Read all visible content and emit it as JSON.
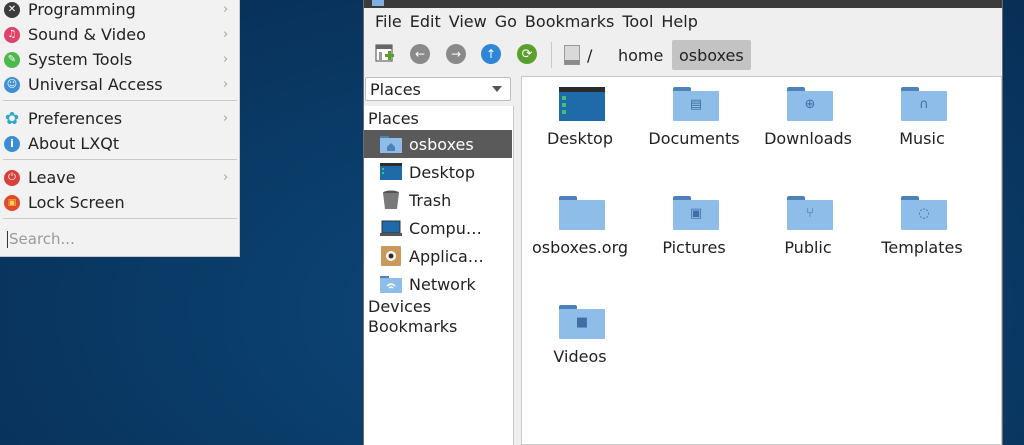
{
  "menu": {
    "items": [
      {
        "label": "Programming",
        "icon": "programming-icon",
        "color": "#3c3c3c",
        "glyph": "✕",
        "submenu": true
      },
      {
        "label": "Sound & Video",
        "icon": "sound-video-icon",
        "color": "#e0436a",
        "glyph": "♫",
        "submenu": true
      },
      {
        "label": "System Tools",
        "icon": "system-tools-icon",
        "color": "#4db84b",
        "glyph": "✎",
        "submenu": true
      },
      {
        "label": "Universal Access",
        "icon": "universal-access-icon",
        "color": "#3d8fd6",
        "glyph": "☺",
        "submenu": true
      },
      {
        "label": "Preferences",
        "icon": "preferences-icon",
        "color": "#2ea7c9",
        "glyph": "✿",
        "submenu": true
      },
      {
        "label": "About LXQt",
        "icon": "about-icon",
        "color": "#3b8ed6",
        "glyph": "i",
        "submenu": false
      },
      {
        "label": "Leave",
        "icon": "leave-icon",
        "color": "#d9403a",
        "glyph": "⏻",
        "submenu": true
      },
      {
        "label": "Lock Screen",
        "icon": "lock-icon",
        "color": "#e0492e",
        "glyph": "▣",
        "submenu": false
      }
    ],
    "search_placeholder": "Search..."
  },
  "window": {
    "menubar": [
      "File",
      "Edit",
      "View",
      "Go",
      "Bookmarks",
      "Tool",
      "Help"
    ],
    "path": {
      "root": "/",
      "crumbs": [
        "home",
        "osboxes"
      ]
    },
    "places_combo": "Places",
    "side": {
      "places_header": "Places",
      "items": [
        {
          "label": "osboxes",
          "icon": "home-folder-icon",
          "selected": true
        },
        {
          "label": "Desktop",
          "icon": "desktop-icon",
          "selected": false
        },
        {
          "label": "Trash",
          "icon": "trash-icon",
          "selected": false
        },
        {
          "label": "Compu…",
          "icon": "computer-icon",
          "selected": false
        },
        {
          "label": "Applica…",
          "icon": "applications-icon",
          "selected": false
        },
        {
          "label": "Network",
          "icon": "network-folder-icon",
          "selected": false
        }
      ],
      "devices_header": "Devices",
      "bookmarks_header": "Bookmarks"
    },
    "files": [
      {
        "name": "Desktop",
        "icon": "desktop-folder-icon"
      },
      {
        "name": "Documents",
        "icon": "documents-folder-icon"
      },
      {
        "name": "Downloads",
        "icon": "downloads-folder-icon"
      },
      {
        "name": "Music",
        "icon": "music-folder-icon"
      },
      {
        "name": "osboxes.org",
        "icon": "folder-icon"
      },
      {
        "name": "Pictures",
        "icon": "pictures-folder-icon"
      },
      {
        "name": "Public",
        "icon": "public-folder-icon"
      },
      {
        "name": "Templates",
        "icon": "templates-folder-icon"
      },
      {
        "name": "Videos",
        "icon": "videos-folder-icon"
      }
    ]
  },
  "colors": {
    "folder": "#8dbde8",
    "folder_dark": "#4d82b8",
    "selection": "#5a5a5a",
    "up_button": "#2f86d6",
    "reload_button": "#5aa02c"
  }
}
